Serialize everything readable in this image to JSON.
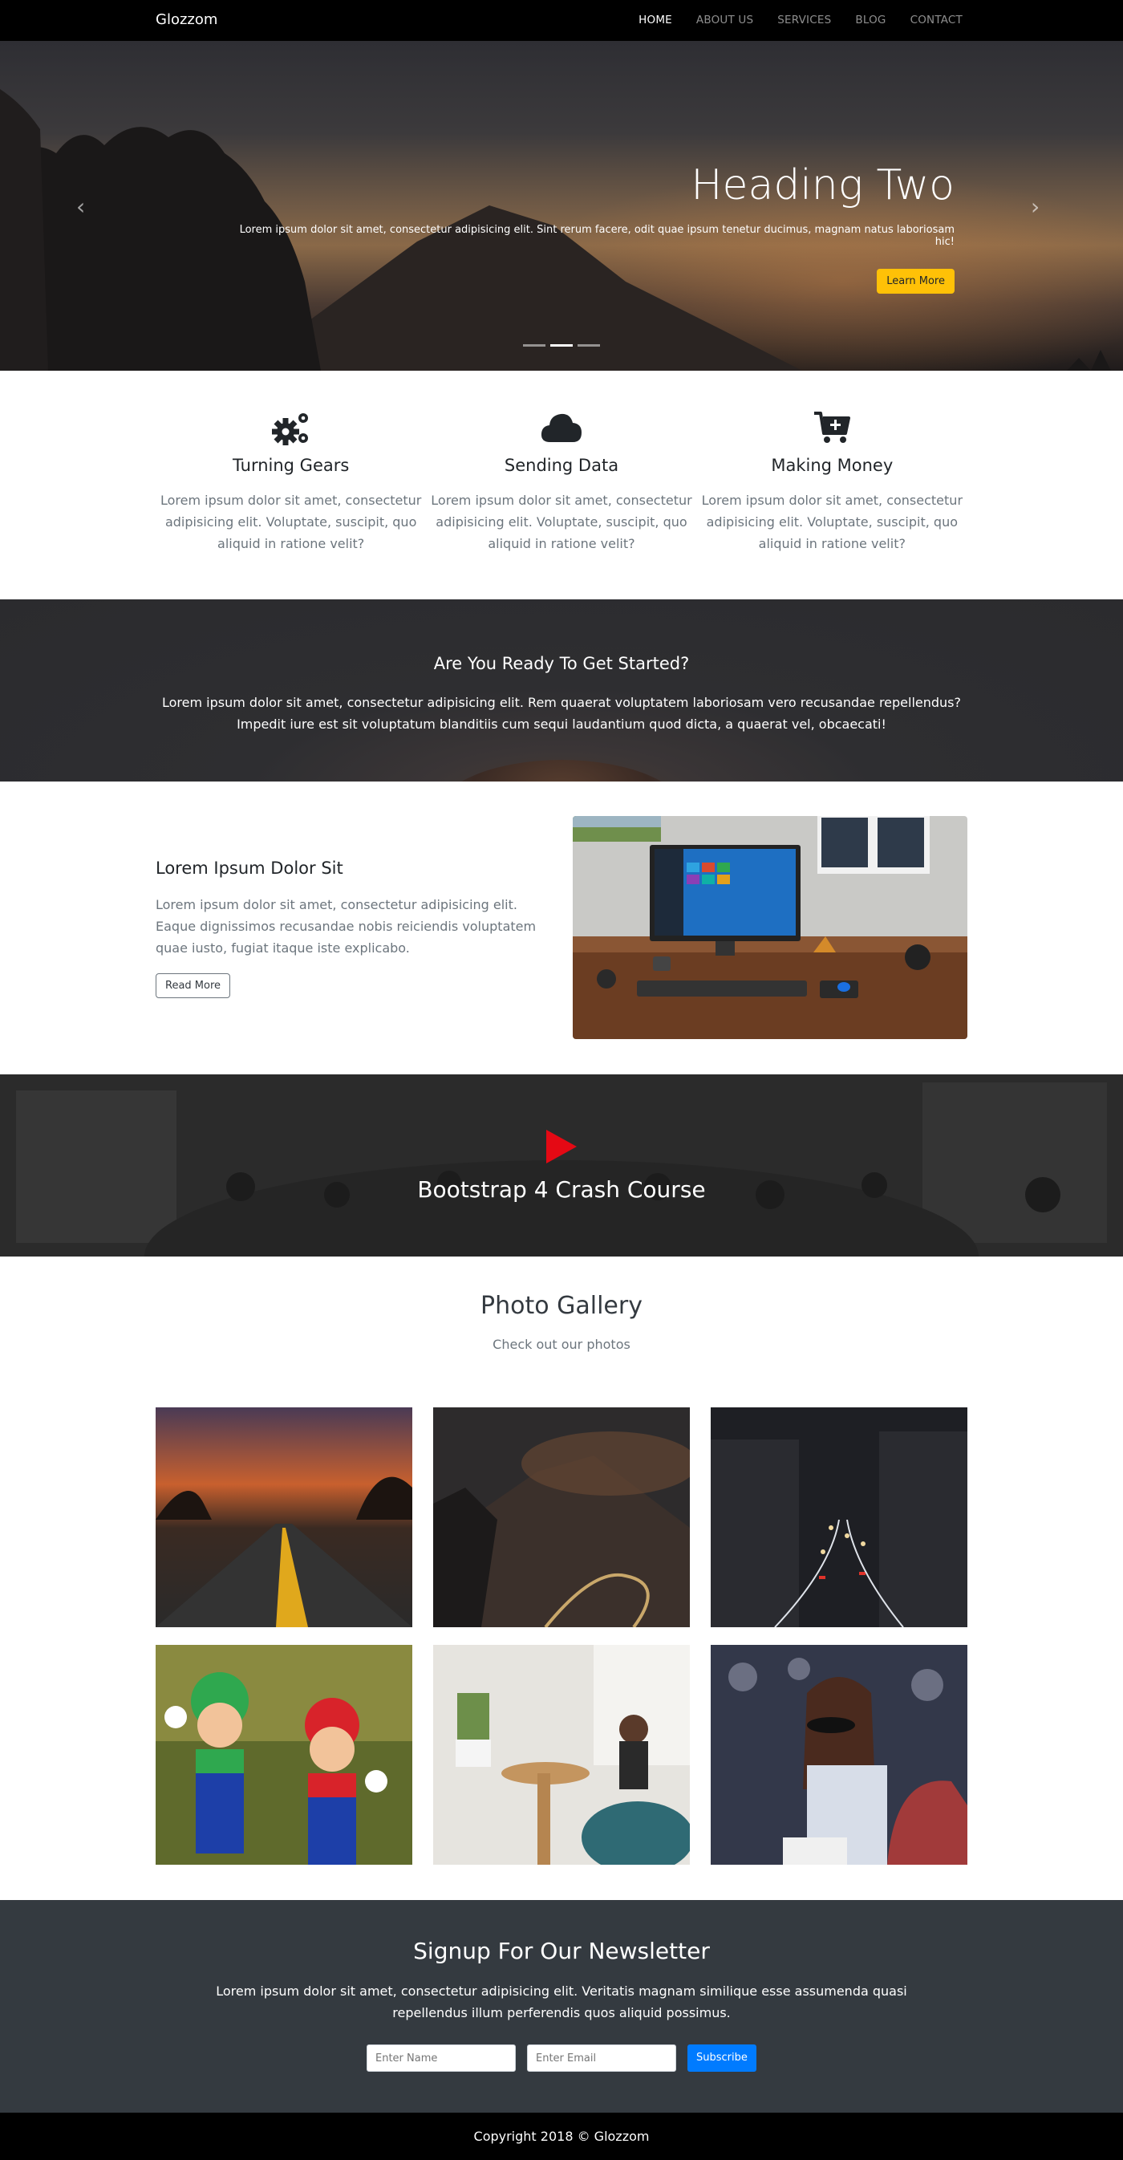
{
  "navbar": {
    "brand": "Glozzom",
    "links": [
      "HOME",
      "ABOUT US",
      "SERVICES",
      "BLOG",
      "CONTACT"
    ]
  },
  "hero": {
    "heading": "Heading Two",
    "text": "Lorem ipsum dolor sit amet, consectetur adipisicing elit. Sint rerum facere, odit quae ipsum tenetur ducimus, magnam natus laboriosam hic!",
    "button": "Learn More",
    "prev_icon": "chevron-left-icon",
    "next_icon": "chevron-right-icon"
  },
  "features": [
    {
      "icon": "cogs-icon",
      "title": "Turning Gears",
      "text": "Lorem ipsum dolor sit amet, consectetur adipisicing elit. Voluptate, suscipit, quo aliquid in ratione velit?"
    },
    {
      "icon": "cloud-icon",
      "title": "Sending Data",
      "text": "Lorem ipsum dolor sit amet, consectetur adipisicing elit. Voluptate, suscipit, quo aliquid in ratione velit?"
    },
    {
      "icon": "cart-plus-icon",
      "title": "Making Money",
      "text": "Lorem ipsum dolor sit amet, consectetur adipisicing elit. Voluptate, suscipit, quo aliquid in ratione velit?"
    }
  ],
  "cta": {
    "title": "Are You Ready To Get Started?",
    "text": "Lorem ipsum dolor sit amet, consectetur adipisicing elit. Rem quaerat voluptatem laboriosam vero recusandae repellendus? Impedit iure est sit voluptatum blanditiis cum sequi laudantium quod dicta, a quaerat vel, obcaecati!"
  },
  "info": {
    "title": "Lorem Ipsum Dolor Sit",
    "text": "Lorem ipsum dolor sit amet, consectetur adipisicing elit. Eaque dignissimos recusandae nobis reiciendis voluptatem quae iusto, fugiat itaque iste explicabo.",
    "button": "Read More"
  },
  "video": {
    "title": "Bootstrap 4 Crash Course",
    "play_icon": "play-icon"
  },
  "gallery": {
    "title": "Photo Gallery",
    "subtitle": "Check out our photos"
  },
  "newsletter": {
    "title": "Signup For Our Newsletter",
    "text": "Lorem ipsum dolor sit amet, consectetur adipisicing elit. Veritatis magnam similique esse assumenda quasi repellendus illum perferendis quos aliquid possimus.",
    "name_placeholder": "Enter Name",
    "email_placeholder": "Enter Email",
    "button": "Subscribe"
  },
  "footer": {
    "copyright": "Copyright 2018 © Glozzom"
  },
  "colors": {
    "navbar": "#000000",
    "accent_warning": "#ffc107",
    "accent_primary": "#007bff",
    "newsletter_bg": "#343a40",
    "play": "#e50914"
  }
}
